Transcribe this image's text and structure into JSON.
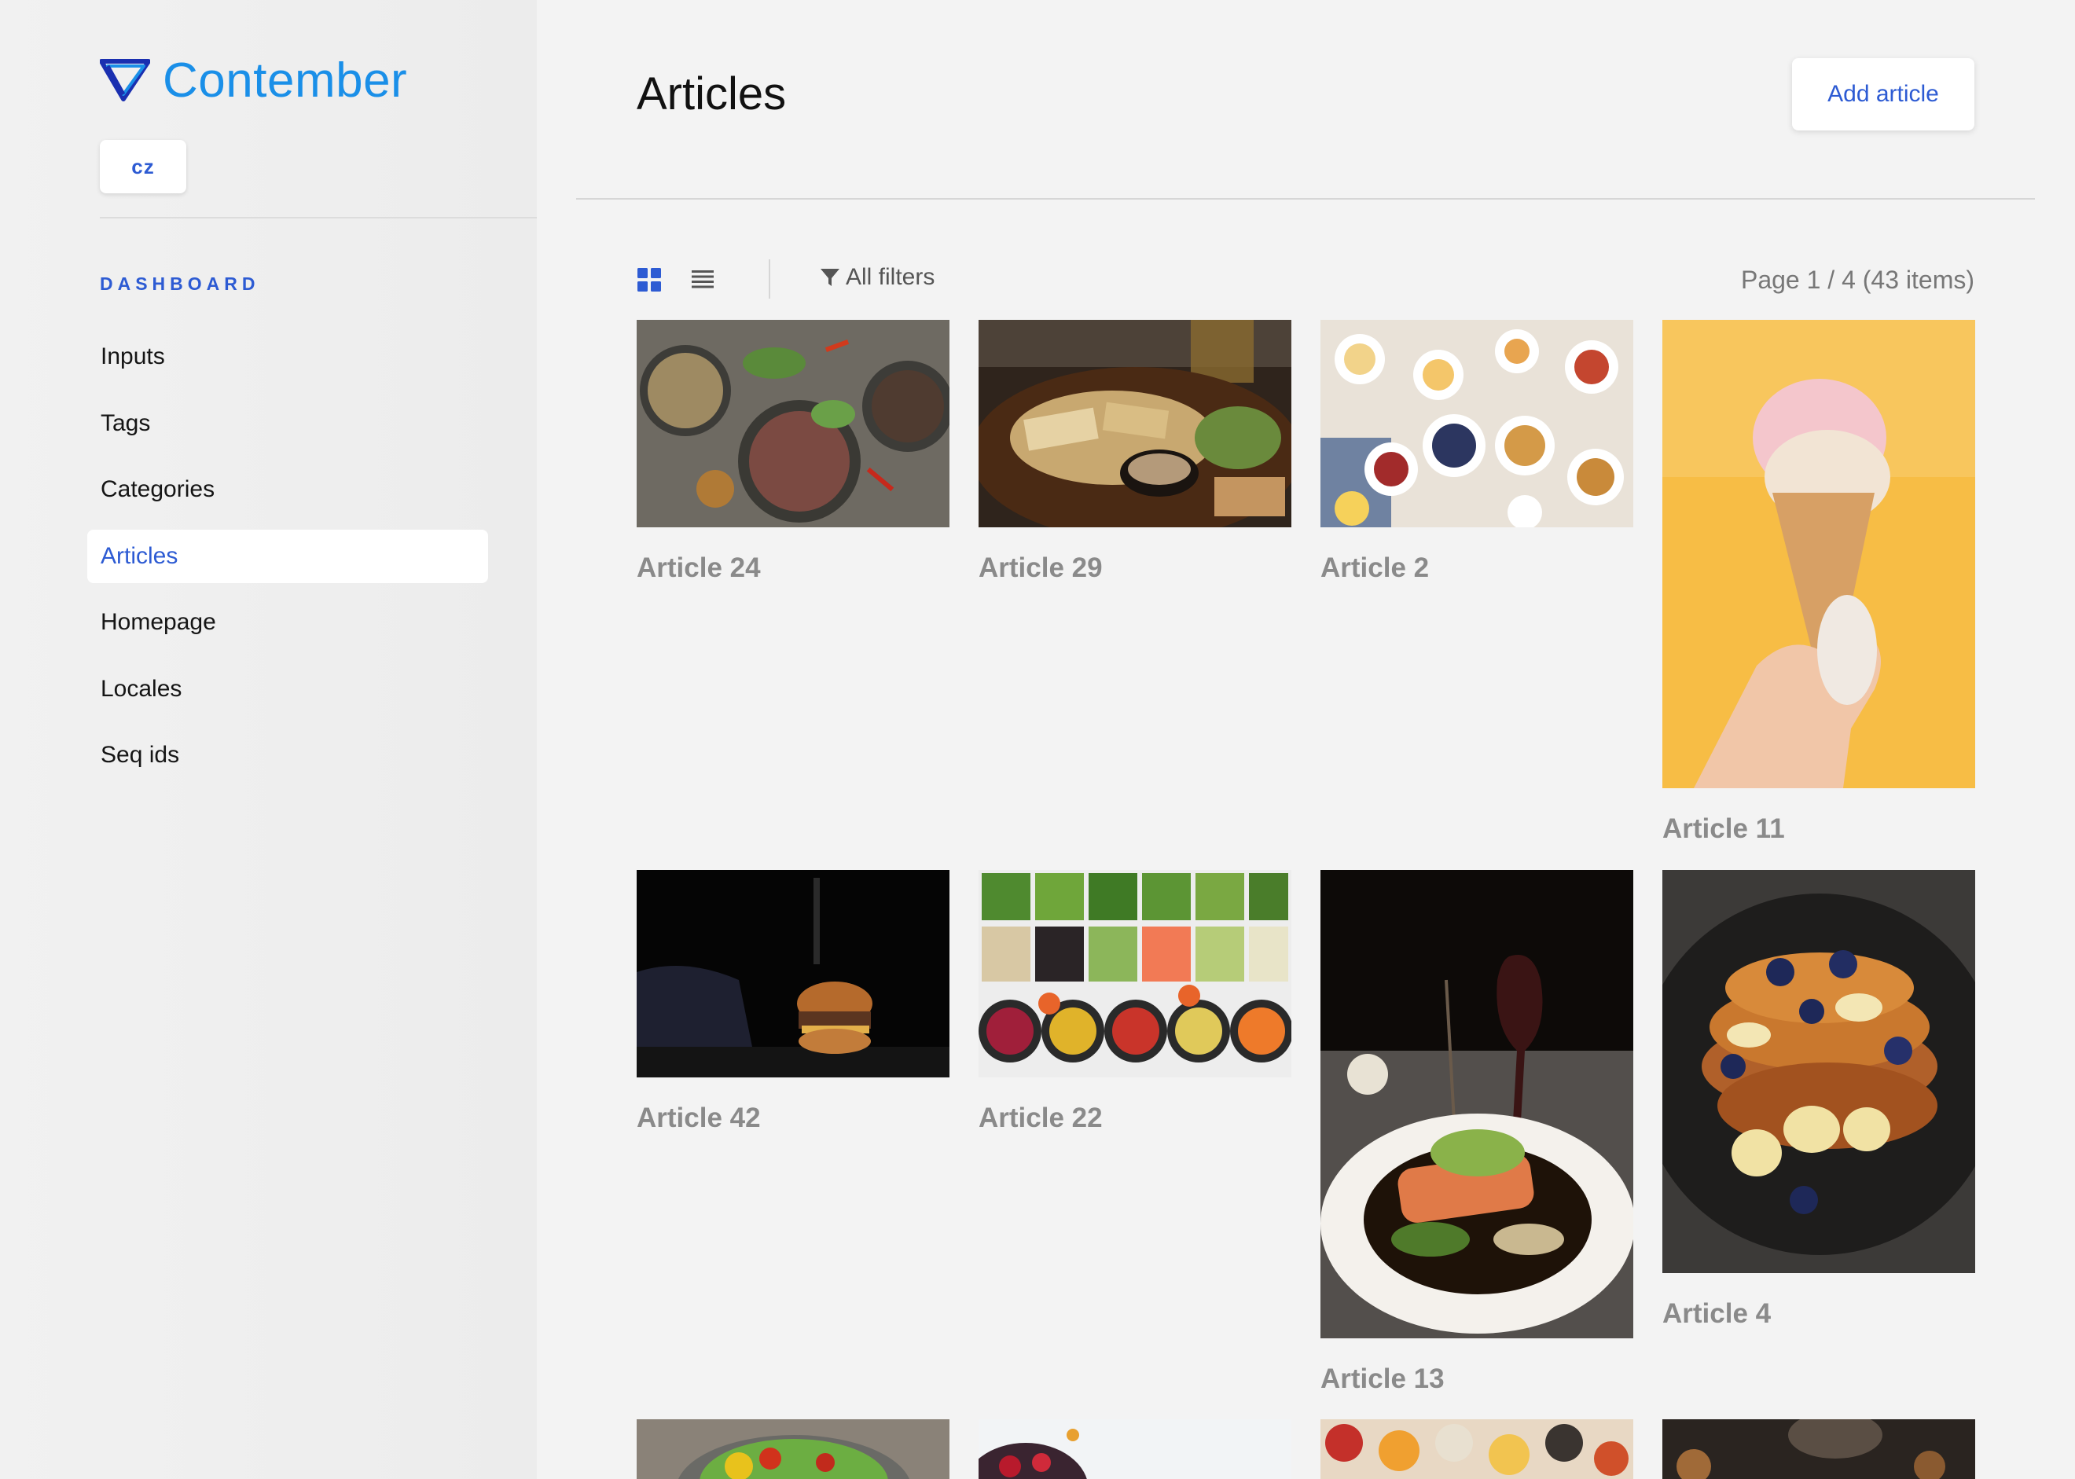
{
  "app": {
    "name": "Contember",
    "brand_color": "#1a8fe8",
    "accent_color": "#2d5bd3"
  },
  "locale": {
    "current": "cz"
  },
  "sidebar": {
    "section_title": "DASHBOARD",
    "items": [
      {
        "label": "Inputs",
        "active": false
      },
      {
        "label": "Tags",
        "active": false
      },
      {
        "label": "Categories",
        "active": false
      },
      {
        "label": "Articles",
        "active": true
      },
      {
        "label": "Homepage",
        "active": false
      },
      {
        "label": "Locales",
        "active": false
      },
      {
        "label": "Seq ids",
        "active": false
      }
    ]
  },
  "main": {
    "title": "Articles",
    "add_button": "Add article",
    "toolbar": {
      "view_mode": "grid",
      "filters_label": "All filters",
      "pagination": "Page 1 / 4 (43 items)"
    },
    "articles": [
      {
        "title": "Article 24",
        "image": "food-bowls-photo"
      },
      {
        "title": "Article 29",
        "image": "grilled-plate-photo"
      },
      {
        "title": "Article 2",
        "image": "breakfast-table-photo"
      },
      {
        "title": "Article 11",
        "image": "ice-cream-cone-photo"
      },
      {
        "title": "Article 42",
        "image": "burger-photo"
      },
      {
        "title": "Article 22",
        "image": "salad-bar-photo"
      },
      {
        "title": "Article 13",
        "image": "salmon-dish-photo"
      },
      {
        "title": "Article 4",
        "image": "french-toast-photo"
      }
    ]
  }
}
